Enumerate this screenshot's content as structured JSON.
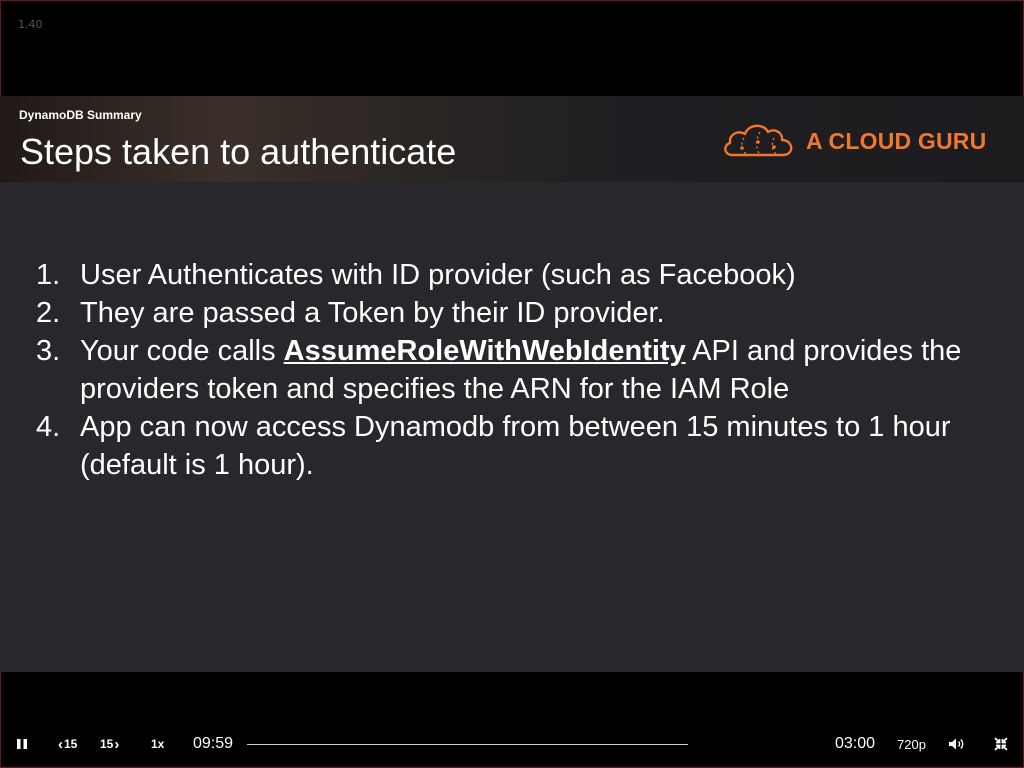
{
  "player": {
    "version_label": "1.40",
    "rewind_label": "15",
    "forward_label": "15",
    "speed_label": "1x",
    "elapsed_time": "09:59",
    "remaining_time": "03:00",
    "quality_label": "720p",
    "progress": 0.0
  },
  "slide": {
    "section_label": "DynamoDB Summary",
    "title": "Steps taken to authenticate",
    "brand_name": "A CLOUD GURU",
    "brand_color": "#f0772b",
    "steps": [
      {
        "number": "1.",
        "text": "User Authenticates with ID provider (such as Facebook)"
      },
      {
        "number": "2.",
        "text": "They are passed a Token by their ID provider."
      },
      {
        "number": "3.",
        "text_before": "Your code calls ",
        "api_name": "AssumeRoleWithWebIdentity",
        "text_after": " API and provides the providers token and specifies the ARN for the IAM Role"
      },
      {
        "number": "4.",
        "text": "App can now access Dynamodb from between 15 minutes to 1 hour (default is 1 hour)."
      }
    ]
  },
  "icons": {
    "play_pause": "pause-icon",
    "rewind": "rewind-15-icon",
    "forward": "forward-15-icon",
    "volume": "volume-icon",
    "fullscreen": "exit-fullscreen-icon",
    "brand_logo": "cloud-logo-icon"
  }
}
